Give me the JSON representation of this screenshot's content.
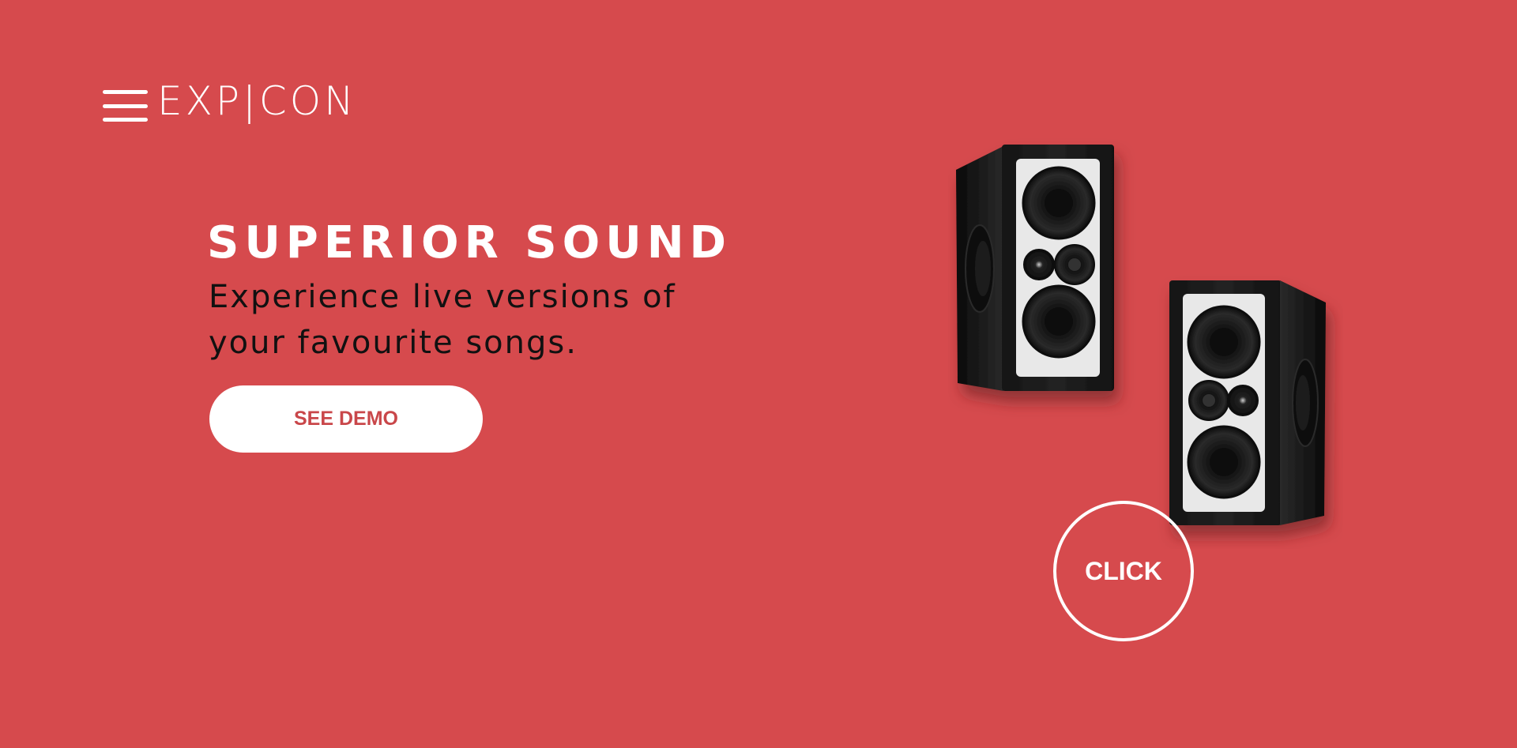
{
  "header": {
    "logo_text": "EXP|CON",
    "menu_icon": "hamburger-menu-icon"
  },
  "hero": {
    "headline": "SUPERIOR SOUND",
    "subheadline": "Experience live versions of your favourite songs.",
    "cta_label": "SEE DEMO"
  },
  "product": {
    "image": "speaker-pair-image",
    "click_label": "CLICK"
  },
  "colors": {
    "background": "#d64a4d",
    "button_text": "#c9474a",
    "white": "#ffffff"
  }
}
